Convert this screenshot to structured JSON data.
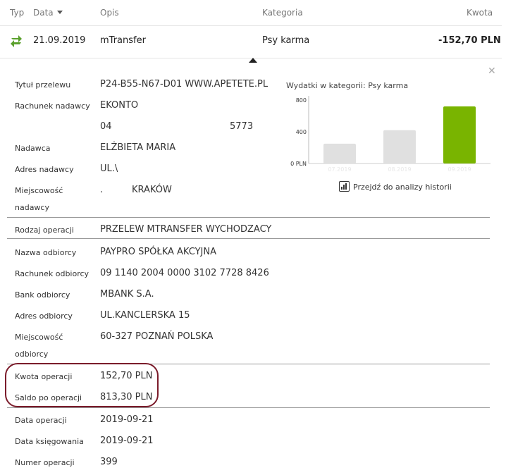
{
  "header": {
    "type": "Typ",
    "date": "Data",
    "description": "Opis",
    "category": "Kategoria",
    "amount": "Kwota"
  },
  "transaction": {
    "date": "21.09.2019",
    "description": "mTransfer",
    "category": "Psy karma",
    "amount": "-152,70 PLN"
  },
  "details": {
    "title_label": "Tytuł przelewu",
    "title_value": "P24-B55-N67-D01 WWW.APETETE.PL",
    "sender_account_label": "Rachunek nadawcy",
    "sender_account_value": "EKONTO",
    "sender_account_no_start": "04",
    "sender_account_no_end": "5773",
    "sender_label": "Nadawca",
    "sender_value": "ELŻBIETA MARIA",
    "sender_address_label": "Adres nadawcy",
    "sender_address_value": "UL.\\",
    "sender_city_label": "Miejscowość",
    "sender_city_label2": "nadawcy",
    "sender_city_prefix": ".",
    "sender_city_value": "KRAKÓW",
    "operation_type_label": "Rodzaj operacji",
    "operation_type_value": "PRZELEW MTRANSFER WYCHODZACY",
    "recipient_name_label": "Nazwa odbiorcy",
    "recipient_name_value": "PAYPRO SPÓŁKA AKCYJNA",
    "recipient_account_label": "Rachunek odbiorcy",
    "recipient_account_value": "09 1140 2004 0000 3102 7728 8426",
    "recipient_bank_label": "Bank odbiorcy",
    "recipient_bank_value": "MBANK S.A.",
    "recipient_address_label": "Adres odbiorcy",
    "recipient_address_value": "UL.KANCLERSKA 15",
    "recipient_city_label": "Miejscowość",
    "recipient_city_label2": "odbiorcy",
    "recipient_city_value": "60-327 POZNAŃ POLSKA",
    "op_amount_label": "Kwota operacji",
    "op_amount_value": "152,70 PLN",
    "balance_label": "Saldo po operacji",
    "balance_value": "813,30 PLN",
    "op_date_label": "Data operacji",
    "op_date_value": "2019-09-21",
    "booking_date_label": "Data księgowania",
    "booking_date_value": "2019-09-21",
    "op_number_label": "Numer operacji",
    "op_number_value": "399"
  },
  "chart_data": {
    "type": "bar",
    "title": "Wydatki w kategorii:",
    "title_category": "Psy karma",
    "categories": [
      "07.2019",
      "08.2019",
      "09.2019"
    ],
    "values": [
      250,
      420,
      720
    ],
    "y_ticks": [
      "800",
      "400",
      "0 PLN"
    ],
    "ylim": [
      0,
      800
    ],
    "bar_colors": [
      "#e0e0e0",
      "#e0e0e0",
      "#79b400"
    ]
  },
  "history_link": "Przejdź do analizy historii",
  "icons": {
    "transfer": "transfer-arrows-icon",
    "close": "close-icon",
    "sort": "sort-down-icon",
    "chart": "bar-chart-icon"
  },
  "colors": {
    "accent_green": "#79b400",
    "highlight": "#7b1c2b"
  }
}
